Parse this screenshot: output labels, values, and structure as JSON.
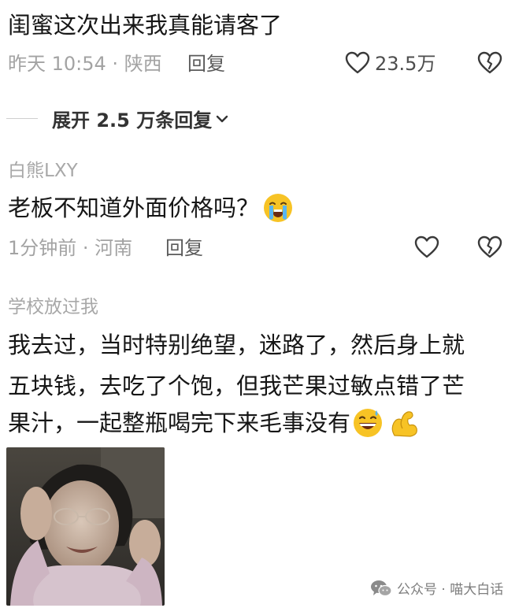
{
  "comment1": {
    "text": "闺蜜这次出来我真能请客了",
    "time": "昨天 10:54",
    "location": "陕西",
    "reply_label": "回复",
    "like_count": "23.5万",
    "expand_label": "展开 2.5 万条回复",
    "expand_icon": "chevron-down-icon"
  },
  "comment2": {
    "username": "白熊LXY",
    "text": "老板不知道外面价格吗？",
    "emoji": "loudly-crying-face",
    "time": "1分钟前",
    "location": "河南",
    "reply_label": "回复"
  },
  "comment3": {
    "username": "学校放过我",
    "lines": [
      "我去过，当时特别绝望，迷路了，然后身上就",
      "五块钱，去吃了个饱，但我芒果过敏点错了芒",
      "果汁，一起整瓶喝完下来毛事没有"
    ],
    "emojis": [
      "grinning-face-with-sweat",
      "flexed-biceps"
    ],
    "image_alt": "reaction-photo"
  },
  "watermark": {
    "icon": "wechat-icon",
    "text": "公众号 · 喵大白话"
  },
  "colors": {
    "meta_gray": "#a3a3a3",
    "text_dark": "#161616",
    "emoji_yellow": "#f7c325"
  }
}
